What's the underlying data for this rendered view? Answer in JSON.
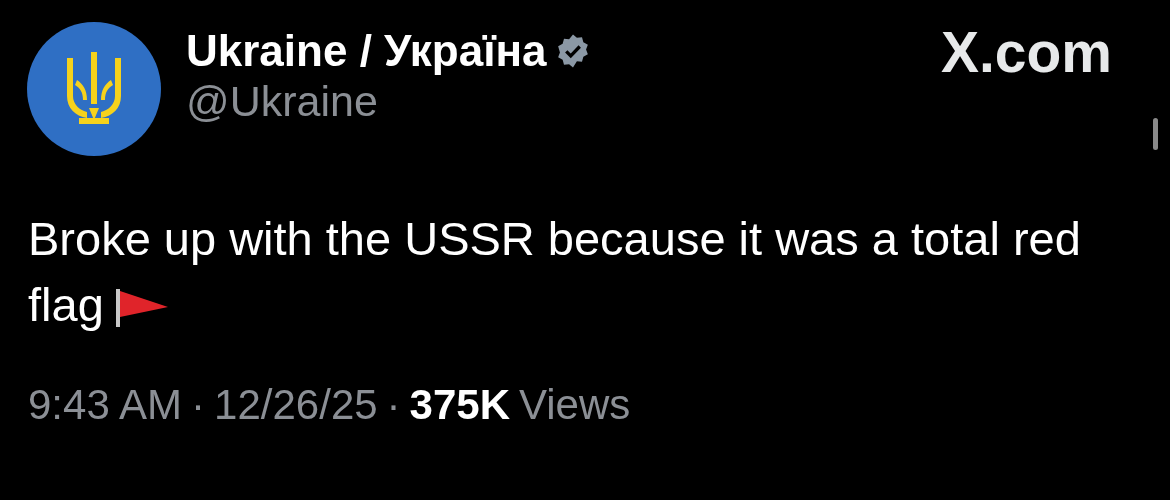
{
  "account": {
    "name": "Ukraine / Україна",
    "verified": true,
    "handle": "@Ukraine"
  },
  "site_label": "X.com",
  "tweet": {
    "text": "Broke up with the USSR because it was a total red flag"
  },
  "meta": {
    "time": "9:43 AM",
    "separator": "·",
    "date": "12/26/25",
    "views_count": "375K",
    "views_label": "Views"
  }
}
